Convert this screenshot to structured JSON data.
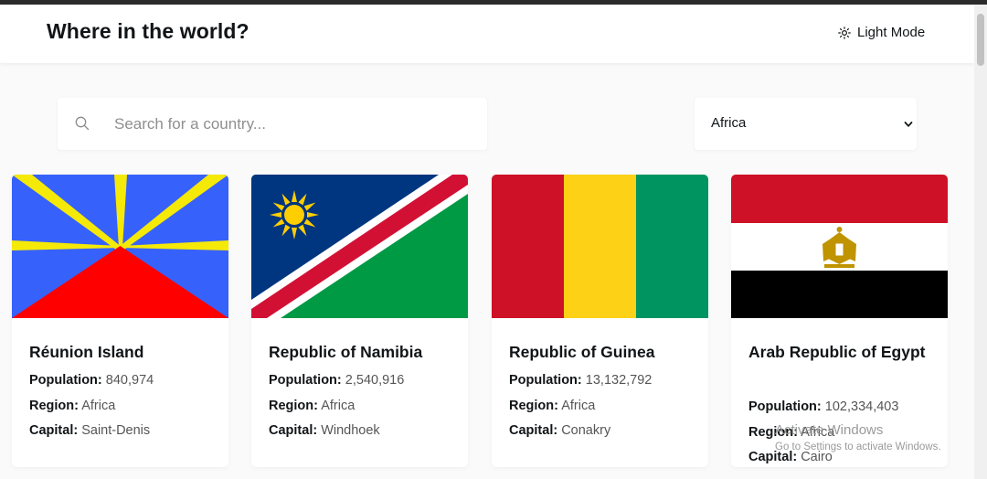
{
  "header": {
    "title": "Where in the world?",
    "mode_label": "Light Mode",
    "mode_icon": "sun-icon"
  },
  "search": {
    "placeholder": "Search for a country...",
    "value": "",
    "icon": "search-icon"
  },
  "filter": {
    "selected": "Africa",
    "icon": "chevron-down-icon"
  },
  "labels": {
    "population": "Population:",
    "region": "Region:",
    "capital": "Capital:"
  },
  "countries": [
    {
      "name": "Réunion Island",
      "population": "840,974",
      "region": "Africa",
      "capital": "Saint-Denis",
      "flag": "reunion-flag"
    },
    {
      "name": "Republic of Namibia",
      "population": "2,540,916",
      "region": "Africa",
      "capital": "Windhoek",
      "flag": "namibia-flag"
    },
    {
      "name": "Republic of Guinea",
      "population": "13,132,792",
      "region": "Africa",
      "capital": "Conakry",
      "flag": "guinea-flag"
    },
    {
      "name": "Arab Republic of Egypt",
      "population": "102,334,403",
      "region": "Africa",
      "capital": "Cairo",
      "flag": "egypt-flag"
    }
  ],
  "watermark": {
    "line1": "Activate Windows",
    "line2": "Go to Settings to activate Windows."
  },
  "colors": {
    "background": "#fafafa",
    "surface": "#ffffff",
    "text": "#111517"
  }
}
